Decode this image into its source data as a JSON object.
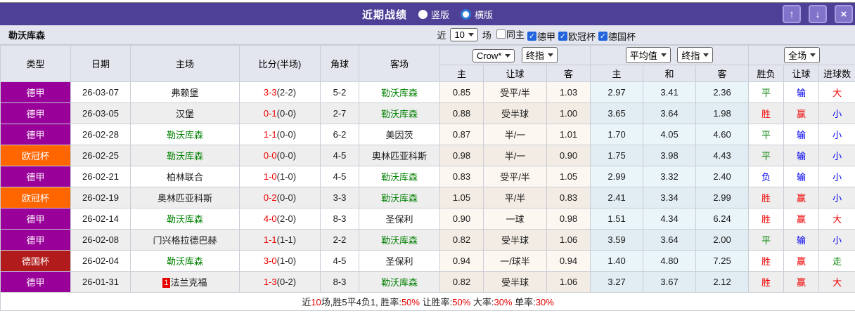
{
  "titlebar": {
    "title": "近期战绩",
    "radio_vertical": "竖版",
    "radio_horizontal": "横版",
    "up_glyph": "↑",
    "down_glyph": "↓",
    "close_glyph": "×"
  },
  "controls": {
    "team": "勒沃库森",
    "recent_prefix": "近",
    "recent_count": "10",
    "recent_suffix": "场",
    "checkboxes": [
      {
        "label": "同主",
        "checked": false
      },
      {
        "label": "德甲",
        "checked": true
      },
      {
        "label": "欧冠杯",
        "checked": true
      },
      {
        "label": "德国杯",
        "checked": true
      }
    ]
  },
  "table": {
    "columns": [
      "类型",
      "日期",
      "主场",
      "比分(半场)",
      "角球",
      "客场"
    ],
    "selects": {
      "crow": "Crow*",
      "final1": "终指",
      "average": "平均值",
      "final2": "终指",
      "scope": "全场"
    },
    "subcols": [
      "主",
      "让球",
      "客",
      "主",
      "和",
      "客",
      "胜负",
      "让球",
      "进球数"
    ],
    "palette": {
      "red": "#f00000",
      "blue": "#0000f0",
      "green": "#008000"
    },
    "rows": [
      {
        "league": "德甲",
        "league_color": "#990099",
        "date": "26-03-07",
        "home": "弗赖堡",
        "home_is_team": false,
        "home_badge": "",
        "score_ft": "3-3",
        "score_ht": "(2-2)",
        "corner": "5-2",
        "away": "勒沃库森",
        "away_is_team": true,
        "odds": [
          "0.85",
          "受平/半",
          "1.03"
        ],
        "avg": [
          "2.97",
          "3.41",
          "2.36"
        ],
        "results": [
          "平",
          "输",
          "大"
        ],
        "result_colors": [
          "green",
          "blue",
          "red"
        ]
      },
      {
        "league": "德甲",
        "league_color": "#990099",
        "date": "26-03-05",
        "home": "汉堡",
        "home_is_team": false,
        "home_badge": "",
        "score_ft": "0-1",
        "score_ht": "(0-0)",
        "corner": "2-7",
        "away": "勒沃库森",
        "away_is_team": true,
        "odds": [
          "0.88",
          "受半球",
          "1.00"
        ],
        "avg": [
          "3.65",
          "3.64",
          "1.98"
        ],
        "results": [
          "胜",
          "赢",
          "小"
        ],
        "result_colors": [
          "red",
          "red",
          "blue"
        ]
      },
      {
        "league": "德甲",
        "league_color": "#990099",
        "date": "26-02-28",
        "home": "勒沃库森",
        "home_is_team": true,
        "home_badge": "",
        "score_ft": "1-1",
        "score_ht": "(0-0)",
        "corner": "6-2",
        "away": "美因茨",
        "away_is_team": false,
        "odds": [
          "0.87",
          "半/一",
          "1.01"
        ],
        "avg": [
          "1.70",
          "4.05",
          "4.60"
        ],
        "results": [
          "平",
          "输",
          "小"
        ],
        "result_colors": [
          "green",
          "blue",
          "blue"
        ]
      },
      {
        "league": "欧冠杯",
        "league_color": "#ff6600",
        "date": "26-02-25",
        "home": "勒沃库森",
        "home_is_team": true,
        "home_badge": "",
        "score_ft": "0-0",
        "score_ht": "(0-0)",
        "corner": "4-5",
        "away": "奥林匹亚科斯",
        "away_is_team": false,
        "odds": [
          "0.98",
          "半/一",
          "0.90"
        ],
        "avg": [
          "1.75",
          "3.98",
          "4.43"
        ],
        "results": [
          "平",
          "输",
          "小"
        ],
        "result_colors": [
          "green",
          "blue",
          "blue"
        ]
      },
      {
        "league": "德甲",
        "league_color": "#990099",
        "date": "26-02-21",
        "home": "柏林联合",
        "home_is_team": false,
        "home_badge": "",
        "score_ft": "1-0",
        "score_ht": "(1-0)",
        "corner": "4-5",
        "away": "勒沃库森",
        "away_is_team": true,
        "odds": [
          "0.83",
          "受平/半",
          "1.05"
        ],
        "avg": [
          "2.99",
          "3.32",
          "2.40"
        ],
        "results": [
          "负",
          "输",
          "小"
        ],
        "result_colors": [
          "blue",
          "blue",
          "blue"
        ]
      },
      {
        "league": "欧冠杯",
        "league_color": "#ff6600",
        "date": "26-02-19",
        "home": "奥林匹亚科斯",
        "home_is_team": false,
        "home_badge": "",
        "score_ft": "0-2",
        "score_ht": "(0-0)",
        "corner": "3-3",
        "away": "勒沃库森",
        "away_is_team": true,
        "odds": [
          "1.05",
          "平/半",
          "0.83"
        ],
        "avg": [
          "2.41",
          "3.34",
          "2.99"
        ],
        "results": [
          "胜",
          "赢",
          "小"
        ],
        "result_colors": [
          "red",
          "red",
          "blue"
        ]
      },
      {
        "league": "德甲",
        "league_color": "#990099",
        "date": "26-02-14",
        "home": "勒沃库森",
        "home_is_team": true,
        "home_badge": "",
        "score_ft": "4-0",
        "score_ht": "(2-0)",
        "corner": "8-3",
        "away": "圣保利",
        "away_is_team": false,
        "odds": [
          "0.90",
          "一球",
          "0.98"
        ],
        "avg": [
          "1.51",
          "4.34",
          "6.24"
        ],
        "results": [
          "胜",
          "赢",
          "大"
        ],
        "result_colors": [
          "red",
          "red",
          "red"
        ]
      },
      {
        "league": "德甲",
        "league_color": "#990099",
        "date": "26-02-08",
        "home": "门兴格拉德巴赫",
        "home_is_team": false,
        "home_badge": "",
        "score_ft": "1-1",
        "score_ht": "(1-1)",
        "corner": "2-2",
        "away": "勒沃库森",
        "away_is_team": true,
        "odds": [
          "0.82",
          "受半球",
          "1.06"
        ],
        "avg": [
          "3.59",
          "3.64",
          "2.00"
        ],
        "results": [
          "平",
          "输",
          "小"
        ],
        "result_colors": [
          "green",
          "blue",
          "blue"
        ]
      },
      {
        "league": "德国杯",
        "league_color": "#b11b1b",
        "date": "26-02-04",
        "home": "勒沃库森",
        "home_is_team": true,
        "home_badge": "",
        "score_ft": "3-0",
        "score_ht": "(1-0)",
        "corner": "4-5",
        "away": "圣保利",
        "away_is_team": false,
        "odds": [
          "0.94",
          "一/球半",
          "0.94"
        ],
        "avg": [
          "1.40",
          "4.80",
          "7.25"
        ],
        "results": [
          "胜",
          "赢",
          "走"
        ],
        "result_colors": [
          "red",
          "red",
          "green"
        ]
      },
      {
        "league": "德甲",
        "league_color": "#990099",
        "date": "26-01-31",
        "home": "法兰克福",
        "home_is_team": false,
        "home_badge": "1",
        "score_ft": "1-3",
        "score_ht": "(0-2)",
        "corner": "8-3",
        "away": "勒沃库森",
        "away_is_team": true,
        "odds": [
          "0.82",
          "受半球",
          "1.06"
        ],
        "avg": [
          "3.27",
          "3.67",
          "2.12"
        ],
        "results": [
          "胜",
          "赢",
          "大"
        ],
        "result_colors": [
          "red",
          "red",
          "red"
        ]
      }
    ]
  },
  "summary": {
    "parts": [
      {
        "text": "近"
      },
      {
        "text": "10",
        "red": true
      },
      {
        "text": "场,胜5平4负1, 胜率:"
      },
      {
        "text": "50%",
        "red": true
      },
      {
        "text": " 让胜率:"
      },
      {
        "text": "50%",
        "red": true
      },
      {
        "text": " 大率:"
      },
      {
        "text": "30%",
        "red": true
      },
      {
        "text": " 单率:"
      },
      {
        "text": "30%",
        "red": true
      }
    ]
  }
}
